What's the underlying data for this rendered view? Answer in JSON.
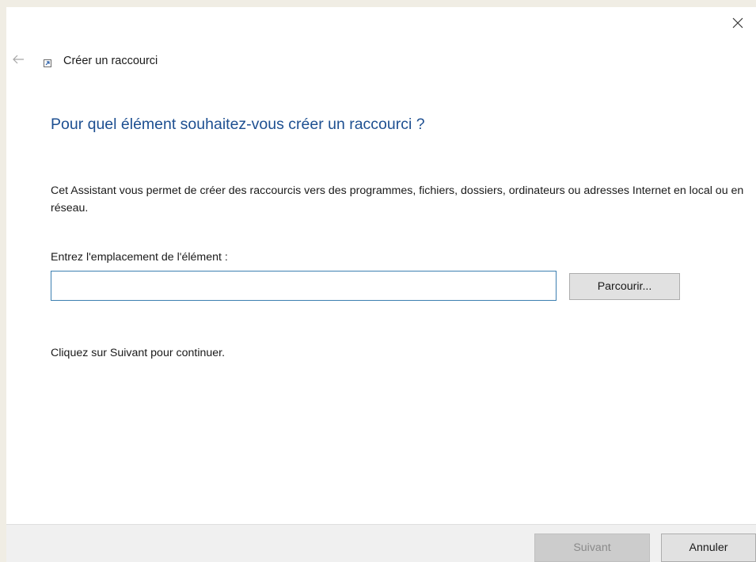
{
  "window": {
    "title": "Créer un raccourci",
    "close_icon": "close-icon",
    "back_icon": "arrow-left-icon",
    "app_icon": "shortcut-icon"
  },
  "main": {
    "heading": "Pour quel élément souhaitez-vous créer un raccourci ?",
    "description": "Cet Assistant vous permet de créer des raccourcis vers des programmes, fichiers, dossiers, ordinateurs ou adresses Internet en local ou en réseau.",
    "location_label": "Entrez l'emplacement de l'élément :",
    "location_value": "",
    "browse_label": "Parcourir...",
    "hint": "Cliquez sur Suivant pour continuer."
  },
  "footer": {
    "next_label": "Suivant",
    "next_enabled": false,
    "cancel_label": "Annuler"
  },
  "colors": {
    "heading": "#1d4f91",
    "input_border": "#3c7fb1",
    "footer_bg": "#f0f0f0"
  }
}
